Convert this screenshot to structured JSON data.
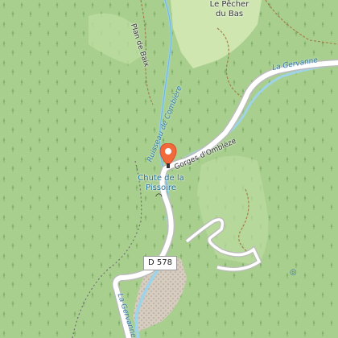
{
  "map": {
    "places": {
      "hamlet": "Le Pêcher du Bas"
    },
    "water": {
      "river_east": "La Gervanne",
      "river_south": "La Gervanne",
      "stream": "Ruisseau de Combière"
    },
    "poi": {
      "waterfall": "Chute de la Pissoire"
    },
    "streets": {
      "gorges": "Gorges d'Omblèze",
      "plan": "Plan de Baix"
    },
    "road_ref": "D 578",
    "marker": {
      "icon": "map-pin-icon",
      "color": "#f26a3c"
    },
    "colors": {
      "forest": "#a9cf8f",
      "meadow": "#cfe6b1",
      "road": "#ffffff",
      "water": "#9fd3e8",
      "rock": "#cfc4b8"
    }
  }
}
